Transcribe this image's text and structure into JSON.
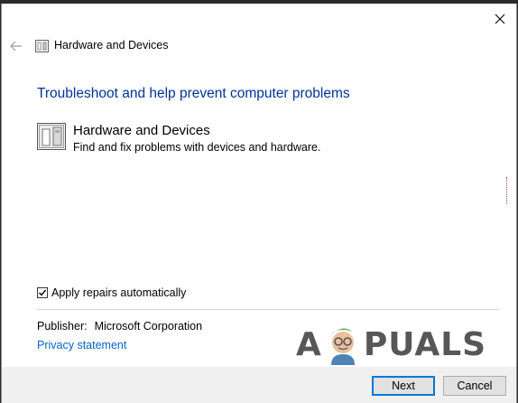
{
  "window": {
    "title": "Hardware and Devices",
    "close_icon": "close-icon",
    "back_icon": "back-arrow-icon"
  },
  "main": {
    "heading": "Troubleshoot and help prevent computer problems",
    "item": {
      "icon": "hardware-devices-icon",
      "title": "Hardware and Devices",
      "description": "Find and fix problems with devices and hardware."
    },
    "apply_repairs": {
      "label": "Apply repairs automatically",
      "checked": true
    },
    "publisher": {
      "label": "Publisher:",
      "value": "Microsoft Corporation"
    },
    "privacy_link": "Privacy statement"
  },
  "watermark": {
    "left": "A",
    "right": "PUALS"
  },
  "footer": {
    "next_label": "Next",
    "cancel_label": "Cancel"
  },
  "colors": {
    "heading": "#003399",
    "link": "#0066cc",
    "accent_border": "#0078d7",
    "footer_bg": "#f0f0f0"
  }
}
